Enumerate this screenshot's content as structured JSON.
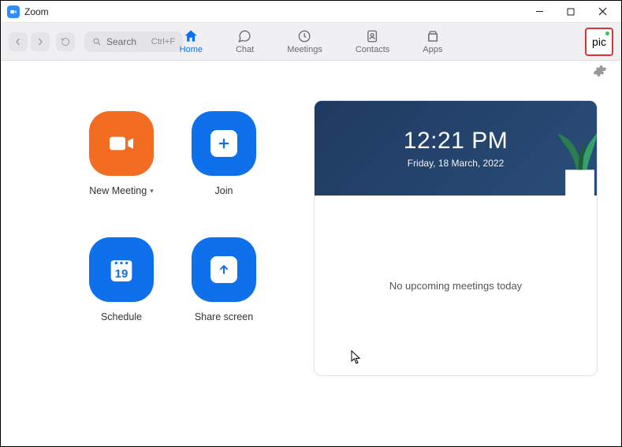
{
  "window": {
    "title": "Zoom"
  },
  "toolbar": {
    "search_placeholder": "Search",
    "search_shortcut": "Ctrl+F"
  },
  "tabs": {
    "home": "Home",
    "chat": "Chat",
    "meetings": "Meetings",
    "contacts": "Contacts",
    "apps": "Apps",
    "active": "home"
  },
  "profile": {
    "label": "pic"
  },
  "actions": {
    "new_meeting": "New Meeting",
    "join": "Join",
    "schedule": "Schedule",
    "schedule_day": "19",
    "share_screen": "Share screen"
  },
  "clock": {
    "time": "12:21 PM",
    "date": "Friday, 18 March, 2022"
  },
  "upcoming": {
    "empty_message": "No upcoming meetings today"
  }
}
